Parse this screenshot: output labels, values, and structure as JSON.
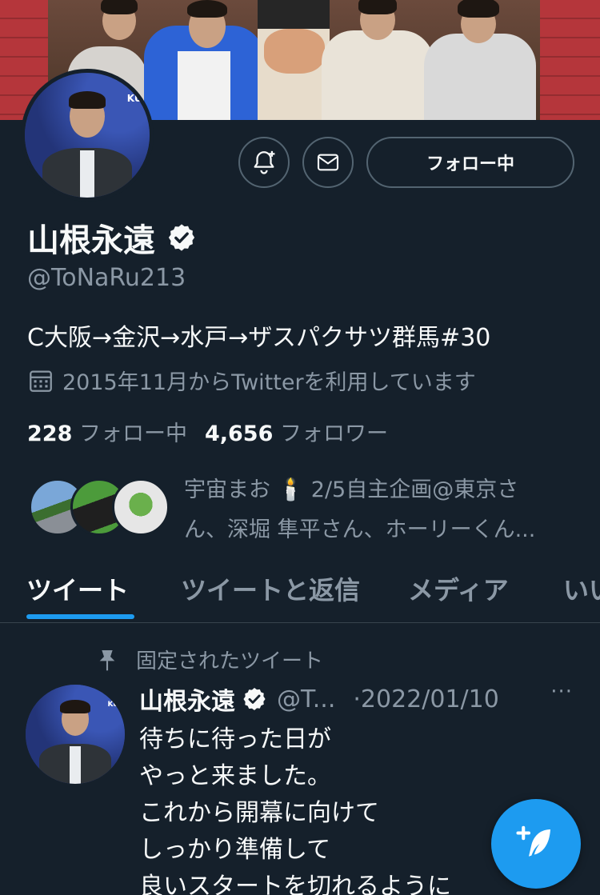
{
  "profile": {
    "name": "山根永遠",
    "handle": "@ToNaRu213",
    "bio": "C大阪→金沢→水戸→ザスパクサツ群馬#30",
    "joined": "2015年11月からTwitterを利用しています",
    "following_count": "228",
    "following_label": "フォロー中",
    "followers_count": "4,656",
    "followers_label": "フォロワー",
    "avatar_text": "KU"
  },
  "buttons": {
    "follow_label": "フォロー中",
    "notify_icon": "bell-plus-icon",
    "message_icon": "mail-icon"
  },
  "known_followers": {
    "line1": "宇宙まお 🕯️ 2/5自主企画@東京さ",
    "line2": "ん、深堀 隼平さん、ホーリーくん..."
  },
  "tabs": [
    {
      "label": "ツイート",
      "active": true
    },
    {
      "label": "ツイートと返信",
      "active": false
    },
    {
      "label": "メディア",
      "active": false
    },
    {
      "label": "いい",
      "active": false
    }
  ],
  "pinned": {
    "label": "固定されたツイート"
  },
  "tweet": {
    "name": "山根永遠",
    "handle": "@T...",
    "date": "·2022/01/10",
    "more": "···",
    "lines": [
      "待ちに待った日が",
      "やっと来ました。",
      "これから開幕に向けて",
      "しっかり準備して",
      "良いスタートを切れるように"
    ]
  },
  "colors": {
    "background": "#15202b",
    "accent": "#1d9bf0",
    "muted": "#8b98a5",
    "border": "#536471"
  }
}
